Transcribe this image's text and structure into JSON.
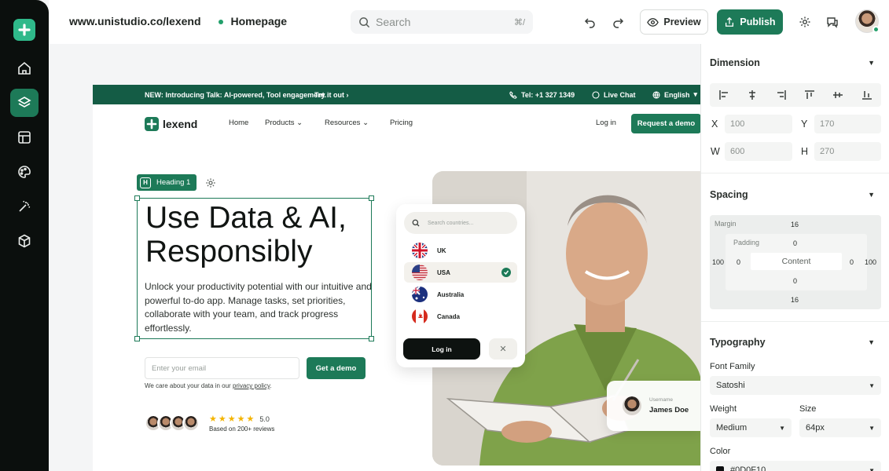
{
  "topbar": {
    "url": "www.unistudio.co/lexend",
    "page": "Homepage",
    "search_placeholder": "Search",
    "search_shortcut": "⌘/",
    "preview_label": "Preview",
    "publish_label": "Publish"
  },
  "site": {
    "announcement": "NEW: Introducing Talk: AI-powered, Tool engagement.",
    "announcement_link": "Try it out",
    "phone": "Tel: +1 327 1349",
    "live_chat": "Live Chat",
    "language": "English",
    "brand": "lexend",
    "nav": [
      "Home",
      "Products",
      "Resources",
      "Pricing"
    ],
    "login": "Log in",
    "request_demo": "Request a demo",
    "element_tag": "Heading 1",
    "heading": "Use Data & AI, Responsibly",
    "lead": "Unlock your productivity potential with our intuitive and powerful to-do app. Manage tasks, set priorities, collaborate with your team, and track progress effortlessly.",
    "email_placeholder": "Enter your email",
    "get_demo": "Get a demo",
    "privacy_prefix": "We care about your data in our",
    "privacy_link": "privacy policy",
    "privacy_suffix": ".",
    "rating": "5.0",
    "reviews": "Based on 200+ reviews",
    "country_search": "Search countries...",
    "countries": [
      "UK",
      "USA",
      "Australia",
      "Canada"
    ],
    "card_login": "Log in",
    "user_label": "Username",
    "user_name": "James Doe"
  },
  "panel": {
    "dimension_title": "Dimension",
    "x_label": "X",
    "x_value": "100",
    "y_label": "Y",
    "y_value": "170",
    "w_label": "W",
    "w_value": "600",
    "h_label": "H",
    "h_value": "270",
    "spacing_title": "Spacing",
    "margin_label": "Margin",
    "padding_label": "Padding",
    "content_label": "Content",
    "margin_top": "16",
    "margin_bottom": "16",
    "margin_left": "100",
    "margin_right": "100",
    "padding_top": "0",
    "padding_bottom": "0",
    "padding_left": "0",
    "padding_right": "0",
    "typography_title": "Typography",
    "font_family_label": "Font Family",
    "font_family_value": "Satoshi",
    "weight_label": "Weight",
    "weight_value": "Medium",
    "size_label": "Size",
    "size_value": "64px",
    "color_label": "Color",
    "color_value": "#0D0F10"
  },
  "colors": {
    "brand": "#1d7a58",
    "announce": "#145c45",
    "rail": "#0b0f0d"
  }
}
